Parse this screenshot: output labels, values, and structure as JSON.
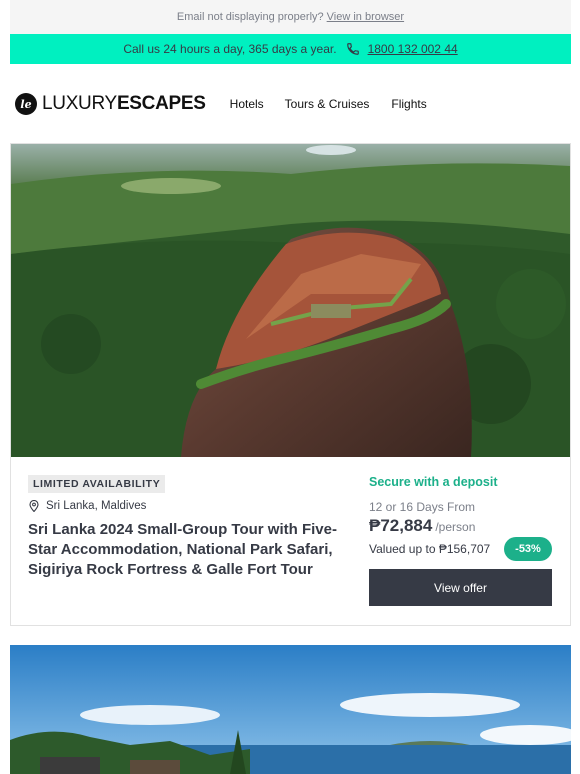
{
  "topbar": {
    "text": "Email not displaying properly?",
    "link": "View in browser"
  },
  "callbar": {
    "text": "Call us 24 hours a day, 365 days a year.",
    "phone": "1800 132 002 44",
    "icon": "phone-icon"
  },
  "brand": {
    "logo_mark": "le",
    "name_light": "LUXURY",
    "name_bold": "ESCAPES"
  },
  "nav": {
    "hotels": "Hotels",
    "tours": "Tours & Cruises",
    "flights": "Flights"
  },
  "offer": {
    "badge": "LIMITED AVAILABILITY",
    "location": "Sri Lanka, Maldives",
    "title": "Sri Lanka 2024 Small-Group Tour with Five-Star Accommodation, National Park Safari, Sigiriya Rock Fortress & Galle Fort Tour",
    "deposit": "Secure with a deposit",
    "duration": "12 or 16 Days From",
    "price": "₱72,884",
    "per": "/person",
    "valued": "Valued up to ₱156,707",
    "discount": "-53%",
    "cta": "View offer"
  },
  "colors": {
    "accent": "#00f0c0",
    "green": "#1cb08a",
    "dark": "#363a45"
  }
}
